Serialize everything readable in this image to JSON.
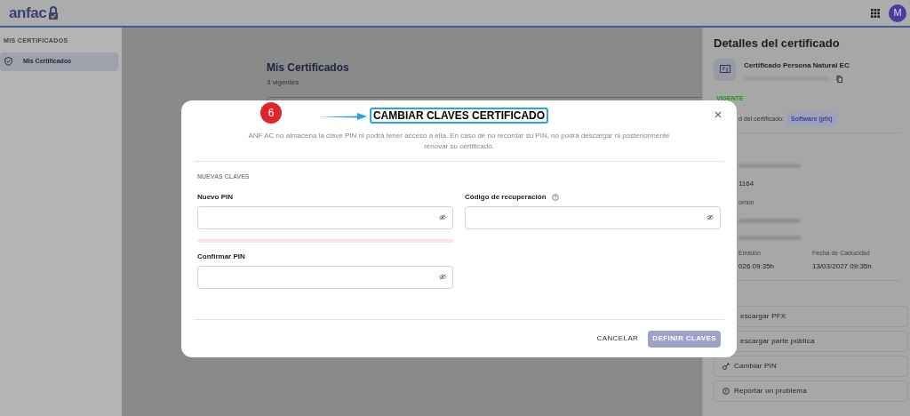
{
  "header": {
    "logo": "anfac",
    "avatar": "M"
  },
  "sidebar": {
    "section": "MIS CERTIFICADOS",
    "items": [
      {
        "label": "Mis Certificados",
        "selected": true
      }
    ]
  },
  "main": {
    "title": "Mis Certificados",
    "subtitle": "3 vigentes"
  },
  "details": {
    "title": "Detalles del certificado",
    "cert_name": "Certificado Persona Natural EC",
    "status": "VIGENTE",
    "type_label": "d del certificado:",
    "type_value": "Software (pfx)",
    "rows": [
      {
        "kind": "redacted"
      },
      {
        "kind": "value",
        "text": "1164"
      },
      {
        "kind": "label",
        "text": "omún"
      },
      {
        "kind": "redacted"
      },
      {
        "kind": "redacted"
      }
    ],
    "dates": [
      {
        "label": "Emisión",
        "value": "026 09:35h"
      },
      {
        "label": "Fecha de Caducidad",
        "value": "13/03/2027 09:35h"
      }
    ],
    "actions": [
      {
        "kind": "plain",
        "label": "escargar PFX"
      },
      {
        "kind": "plain",
        "label": "escargar parte pública"
      },
      {
        "kind": "key",
        "label": "Cambiar PIN"
      },
      {
        "kind": "alert",
        "label": "Reportar un problema"
      }
    ]
  },
  "modal": {
    "step": "6",
    "title": "CAMBIAR CLAVES CERTIFICADO",
    "description": "ANF AC no almacena la clave PIN ni podrá tener acceso a ella. En caso de no recordar su PIN, no podrá descargar ni posteriormente renovar su certificado.",
    "section": "NUEVAS CLAVES",
    "fields": [
      {
        "label": "Nuevo PIN",
        "help": false
      },
      {
        "label": "Código de recuperación",
        "help": true
      },
      {
        "label": "Confirmar PIN",
        "help": false
      }
    ],
    "strength": {
      "level": 0
    },
    "cancel": "CANCELAR",
    "submit": {
      "label": "DEFINIR CLAVES",
      "disabled": true
    }
  }
}
